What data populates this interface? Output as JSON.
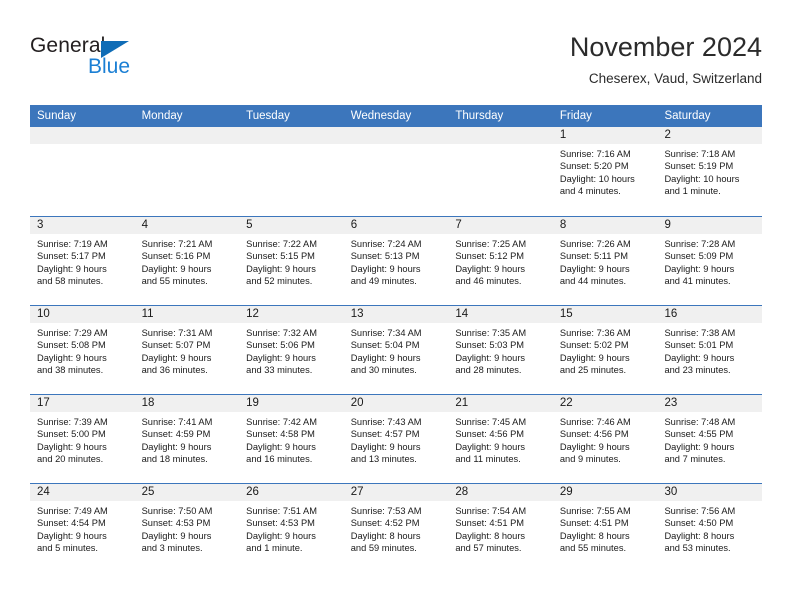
{
  "brand": {
    "name_part1": "General",
    "name_part2": "Blue",
    "triangle_icon": "triangle-icon",
    "color_dark": "#231f20",
    "color_blue": "#1b7fd4"
  },
  "header": {
    "title": "November 2024",
    "subtitle": "Cheserex, Vaud, Switzerland"
  },
  "calendar": {
    "accent_color": "#3c76bc",
    "day_band_color": "#f0f0f0",
    "weekday_headers": [
      "Sunday",
      "Monday",
      "Tuesday",
      "Wednesday",
      "Thursday",
      "Friday",
      "Saturday"
    ],
    "weeks": [
      [
        {
          "day": "",
          "empty": true,
          "sunrise": "",
          "sunset": "",
          "daylight_line1": "",
          "daylight_line2": ""
        },
        {
          "day": "",
          "empty": true,
          "sunrise": "",
          "sunset": "",
          "daylight_line1": "",
          "daylight_line2": ""
        },
        {
          "day": "",
          "empty": true,
          "sunrise": "",
          "sunset": "",
          "daylight_line1": "",
          "daylight_line2": ""
        },
        {
          "day": "",
          "empty": true,
          "sunrise": "",
          "sunset": "",
          "daylight_line1": "",
          "daylight_line2": ""
        },
        {
          "day": "",
          "empty": true,
          "sunrise": "",
          "sunset": "",
          "daylight_line1": "",
          "daylight_line2": ""
        },
        {
          "day": "1",
          "empty": false,
          "sunrise": "Sunrise: 7:16 AM",
          "sunset": "Sunset: 5:20 PM",
          "daylight_line1": "Daylight: 10 hours",
          "daylight_line2": "and 4 minutes."
        },
        {
          "day": "2",
          "empty": false,
          "sunrise": "Sunrise: 7:18 AM",
          "sunset": "Sunset: 5:19 PM",
          "daylight_line1": "Daylight: 10 hours",
          "daylight_line2": "and 1 minute."
        }
      ],
      [
        {
          "day": "3",
          "empty": false,
          "sunrise": "Sunrise: 7:19 AM",
          "sunset": "Sunset: 5:17 PM",
          "daylight_line1": "Daylight: 9 hours",
          "daylight_line2": "and 58 minutes."
        },
        {
          "day": "4",
          "empty": false,
          "sunrise": "Sunrise: 7:21 AM",
          "sunset": "Sunset: 5:16 PM",
          "daylight_line1": "Daylight: 9 hours",
          "daylight_line2": "and 55 minutes."
        },
        {
          "day": "5",
          "empty": false,
          "sunrise": "Sunrise: 7:22 AM",
          "sunset": "Sunset: 5:15 PM",
          "daylight_line1": "Daylight: 9 hours",
          "daylight_line2": "and 52 minutes."
        },
        {
          "day": "6",
          "empty": false,
          "sunrise": "Sunrise: 7:24 AM",
          "sunset": "Sunset: 5:13 PM",
          "daylight_line1": "Daylight: 9 hours",
          "daylight_line2": "and 49 minutes."
        },
        {
          "day": "7",
          "empty": false,
          "sunrise": "Sunrise: 7:25 AM",
          "sunset": "Sunset: 5:12 PM",
          "daylight_line1": "Daylight: 9 hours",
          "daylight_line2": "and 46 minutes."
        },
        {
          "day": "8",
          "empty": false,
          "sunrise": "Sunrise: 7:26 AM",
          "sunset": "Sunset: 5:11 PM",
          "daylight_line1": "Daylight: 9 hours",
          "daylight_line2": "and 44 minutes."
        },
        {
          "day": "9",
          "empty": false,
          "sunrise": "Sunrise: 7:28 AM",
          "sunset": "Sunset: 5:09 PM",
          "daylight_line1": "Daylight: 9 hours",
          "daylight_line2": "and 41 minutes."
        }
      ],
      [
        {
          "day": "10",
          "empty": false,
          "sunrise": "Sunrise: 7:29 AM",
          "sunset": "Sunset: 5:08 PM",
          "daylight_line1": "Daylight: 9 hours",
          "daylight_line2": "and 38 minutes."
        },
        {
          "day": "11",
          "empty": false,
          "sunrise": "Sunrise: 7:31 AM",
          "sunset": "Sunset: 5:07 PM",
          "daylight_line1": "Daylight: 9 hours",
          "daylight_line2": "and 36 minutes."
        },
        {
          "day": "12",
          "empty": false,
          "sunrise": "Sunrise: 7:32 AM",
          "sunset": "Sunset: 5:06 PM",
          "daylight_line1": "Daylight: 9 hours",
          "daylight_line2": "and 33 minutes."
        },
        {
          "day": "13",
          "empty": false,
          "sunrise": "Sunrise: 7:34 AM",
          "sunset": "Sunset: 5:04 PM",
          "daylight_line1": "Daylight: 9 hours",
          "daylight_line2": "and 30 minutes."
        },
        {
          "day": "14",
          "empty": false,
          "sunrise": "Sunrise: 7:35 AM",
          "sunset": "Sunset: 5:03 PM",
          "daylight_line1": "Daylight: 9 hours",
          "daylight_line2": "and 28 minutes."
        },
        {
          "day": "15",
          "empty": false,
          "sunrise": "Sunrise: 7:36 AM",
          "sunset": "Sunset: 5:02 PM",
          "daylight_line1": "Daylight: 9 hours",
          "daylight_line2": "and 25 minutes."
        },
        {
          "day": "16",
          "empty": false,
          "sunrise": "Sunrise: 7:38 AM",
          "sunset": "Sunset: 5:01 PM",
          "daylight_line1": "Daylight: 9 hours",
          "daylight_line2": "and 23 minutes."
        }
      ],
      [
        {
          "day": "17",
          "empty": false,
          "sunrise": "Sunrise: 7:39 AM",
          "sunset": "Sunset: 5:00 PM",
          "daylight_line1": "Daylight: 9 hours",
          "daylight_line2": "and 20 minutes."
        },
        {
          "day": "18",
          "empty": false,
          "sunrise": "Sunrise: 7:41 AM",
          "sunset": "Sunset: 4:59 PM",
          "daylight_line1": "Daylight: 9 hours",
          "daylight_line2": "and 18 minutes."
        },
        {
          "day": "19",
          "empty": false,
          "sunrise": "Sunrise: 7:42 AM",
          "sunset": "Sunset: 4:58 PM",
          "daylight_line1": "Daylight: 9 hours",
          "daylight_line2": "and 16 minutes."
        },
        {
          "day": "20",
          "empty": false,
          "sunrise": "Sunrise: 7:43 AM",
          "sunset": "Sunset: 4:57 PM",
          "daylight_line1": "Daylight: 9 hours",
          "daylight_line2": "and 13 minutes."
        },
        {
          "day": "21",
          "empty": false,
          "sunrise": "Sunrise: 7:45 AM",
          "sunset": "Sunset: 4:56 PM",
          "daylight_line1": "Daylight: 9 hours",
          "daylight_line2": "and 11 minutes."
        },
        {
          "day": "22",
          "empty": false,
          "sunrise": "Sunrise: 7:46 AM",
          "sunset": "Sunset: 4:56 PM",
          "daylight_line1": "Daylight: 9 hours",
          "daylight_line2": "and 9 minutes."
        },
        {
          "day": "23",
          "empty": false,
          "sunrise": "Sunrise: 7:48 AM",
          "sunset": "Sunset: 4:55 PM",
          "daylight_line1": "Daylight: 9 hours",
          "daylight_line2": "and 7 minutes."
        }
      ],
      [
        {
          "day": "24",
          "empty": false,
          "sunrise": "Sunrise: 7:49 AM",
          "sunset": "Sunset: 4:54 PM",
          "daylight_line1": "Daylight: 9 hours",
          "daylight_line2": "and 5 minutes."
        },
        {
          "day": "25",
          "empty": false,
          "sunrise": "Sunrise: 7:50 AM",
          "sunset": "Sunset: 4:53 PM",
          "daylight_line1": "Daylight: 9 hours",
          "daylight_line2": "and 3 minutes."
        },
        {
          "day": "26",
          "empty": false,
          "sunrise": "Sunrise: 7:51 AM",
          "sunset": "Sunset: 4:53 PM",
          "daylight_line1": "Daylight: 9 hours",
          "daylight_line2": "and 1 minute."
        },
        {
          "day": "27",
          "empty": false,
          "sunrise": "Sunrise: 7:53 AM",
          "sunset": "Sunset: 4:52 PM",
          "daylight_line1": "Daylight: 8 hours",
          "daylight_line2": "and 59 minutes."
        },
        {
          "day": "28",
          "empty": false,
          "sunrise": "Sunrise: 7:54 AM",
          "sunset": "Sunset: 4:51 PM",
          "daylight_line1": "Daylight: 8 hours",
          "daylight_line2": "and 57 minutes."
        },
        {
          "day": "29",
          "empty": false,
          "sunrise": "Sunrise: 7:55 AM",
          "sunset": "Sunset: 4:51 PM",
          "daylight_line1": "Daylight: 8 hours",
          "daylight_line2": "and 55 minutes."
        },
        {
          "day": "30",
          "empty": false,
          "sunrise": "Sunrise: 7:56 AM",
          "sunset": "Sunset: 4:50 PM",
          "daylight_line1": "Daylight: 8 hours",
          "daylight_line2": "and 53 minutes."
        }
      ]
    ]
  }
}
